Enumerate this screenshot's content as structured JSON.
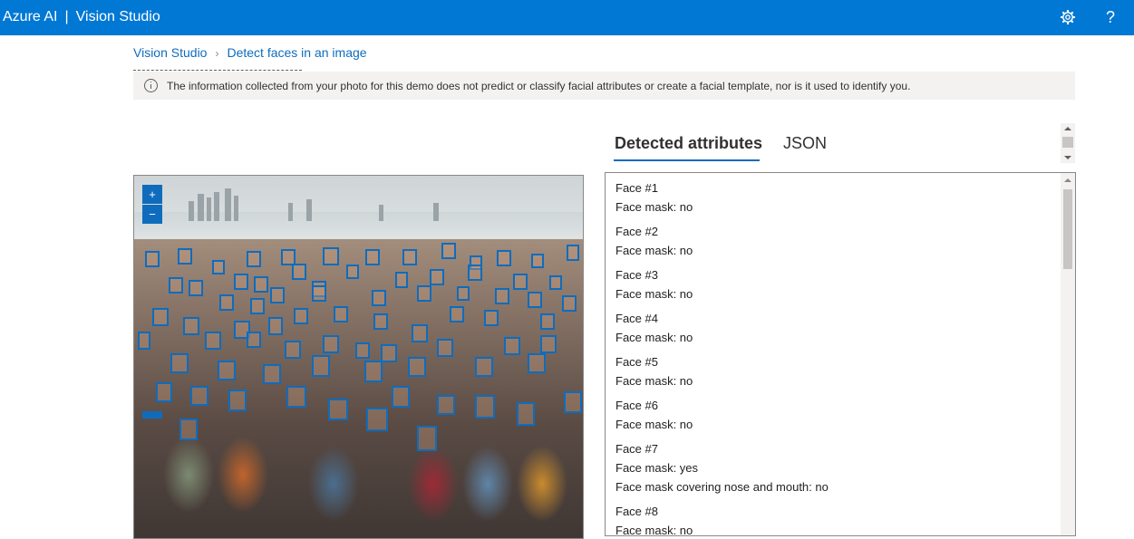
{
  "header": {
    "brand": "Azure AI",
    "divider": "|",
    "product": "Vision Studio",
    "settings_icon": "gear-icon",
    "help_icon": "help-question-icon",
    "help_glyph": "?"
  },
  "breadcrumb": {
    "home": "Vision Studio",
    "separator": "›",
    "current": "Detect faces in an image"
  },
  "notice": {
    "icon": "info-icon",
    "text": "The information collected from your photo for this demo does not predict or classify facial attributes or create a facial template, nor is it used to identify you."
  },
  "image_panel": {
    "zoom_in_glyph": "+",
    "zoom_out_glyph": "−"
  },
  "tabs": [
    {
      "label": "Detected attributes",
      "active": true
    },
    {
      "label": "JSON",
      "active": false
    }
  ],
  "faces": [
    {
      "title": "Face #1",
      "lines": [
        "Face mask: no"
      ]
    },
    {
      "title": "Face #2",
      "lines": [
        "Face mask: no"
      ]
    },
    {
      "title": "Face #3",
      "lines": [
        "Face mask: no"
      ]
    },
    {
      "title": "Face #4",
      "lines": [
        "Face mask: no"
      ]
    },
    {
      "title": "Face #5",
      "lines": [
        "Face mask: no"
      ]
    },
    {
      "title": "Face #6",
      "lines": [
        "Face mask: no"
      ]
    },
    {
      "title": "Face #7",
      "lines": [
        "Face mask: yes",
        "Face mask covering nose and mouth: no"
      ]
    },
    {
      "title": "Face #8",
      "lines": [
        "Face mask: no"
      ]
    }
  ],
  "colors": {
    "accent": "#0078d4",
    "link": "#0f6cbd",
    "notice_bg": "#f3f2f1"
  }
}
